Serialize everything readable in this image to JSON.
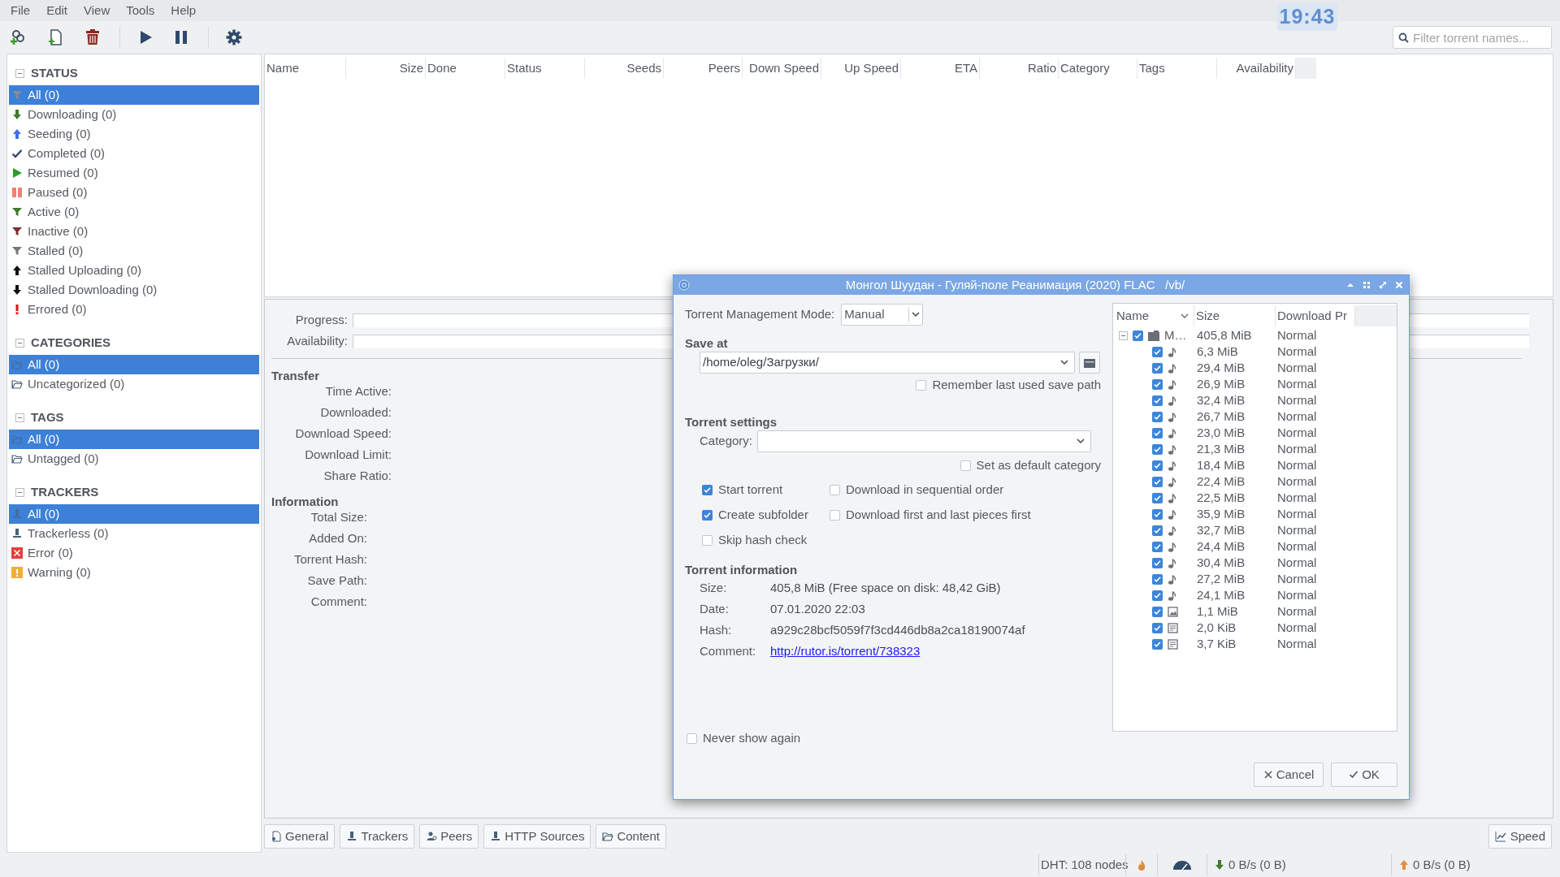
{
  "menu": [
    "File",
    "Edit",
    "View",
    "Tools",
    "Help"
  ],
  "clock": "19:43",
  "filter": {
    "placeholder": "Filter torrent names..."
  },
  "sidebar": [
    {
      "title": "STATUS",
      "expanded": true,
      "items": [
        {
          "label": "All (0)",
          "kind": "all",
          "selected": true
        },
        {
          "label": "Downloading (0)",
          "kind": "downloading",
          "selected": false
        },
        {
          "label": "Seeding (0)",
          "kind": "seeding",
          "selected": false
        },
        {
          "label": "Completed (0)",
          "kind": "completed",
          "selected": false
        },
        {
          "label": "Resumed (0)",
          "kind": "resumed",
          "selected": false
        },
        {
          "label": "Paused (0)",
          "kind": "paused",
          "selected": false
        },
        {
          "label": "Active (0)",
          "kind": "active",
          "selected": false
        },
        {
          "label": "Inactive (0)",
          "kind": "inactive",
          "selected": false
        },
        {
          "label": "Stalled (0)",
          "kind": "stalled",
          "selected": false
        },
        {
          "label": "Stalled Uploading (0)",
          "kind": "stalled_uploading",
          "selected": false
        },
        {
          "label": "Stalled Downloading (0)",
          "kind": "stalled_downloading",
          "selected": false
        },
        {
          "label": "Errored (0)",
          "kind": "errored",
          "selected": false
        }
      ]
    },
    {
      "title": "CATEGORIES",
      "expanded": true,
      "items": [
        {
          "label": "All (0)",
          "kind": "folder",
          "selected": true
        },
        {
          "label": "Uncategorized (0)",
          "kind": "folder",
          "selected": false
        }
      ]
    },
    {
      "title": "TAGS",
      "expanded": true,
      "items": [
        {
          "label": "All (0)",
          "kind": "folder",
          "selected": true
        },
        {
          "label": "Untagged (0)",
          "kind": "folder",
          "selected": false
        }
      ]
    },
    {
      "title": "TRACKERS",
      "expanded": true,
      "items": [
        {
          "label": "All (0)",
          "kind": "tracker",
          "selected": true
        },
        {
          "label": "Trackerless (0)",
          "kind": "tracker",
          "selected": false
        },
        {
          "label": "Error (0)",
          "kind": "error",
          "selected": false
        },
        {
          "label": "Warning (0)",
          "kind": "warning",
          "selected": false
        }
      ]
    }
  ],
  "torrent_table": {
    "columns": [
      "Name",
      "Size",
      "Done",
      "Status",
      "Seeds",
      "Peers",
      "Down Speed",
      "Up Speed",
      "ETA",
      "Ratio",
      "Category",
      "Tags",
      "Availability"
    ]
  },
  "details": {
    "bars": [
      {
        "label": "Progress:",
        "level": 0
      },
      {
        "label": "Availability:",
        "level": 0
      }
    ],
    "sections": [
      {
        "title": "Transfer",
        "fields": [
          "Time Active:",
          "Downloaded:",
          "Download Speed:",
          "Download Limit:",
          "Share Ratio:"
        ]
      },
      {
        "title": "Information",
        "fields": [
          "Total Size:",
          "Added On:",
          "Torrent Hash:",
          "Save Path:",
          "Comment:"
        ]
      }
    ]
  },
  "bottom_tabs": [
    {
      "label": "General",
      "kind": "general"
    },
    {
      "label": "Trackers",
      "kind": "trackers"
    },
    {
      "label": "Peers",
      "kind": "peers"
    },
    {
      "label": "HTTP Sources",
      "kind": "sources"
    },
    {
      "label": "Content",
      "kind": "content"
    }
  ],
  "speed_button": "Speed",
  "status_bar": {
    "dht": "DHT: 108 nodes",
    "download": "0 B/s (0 B)",
    "upload": "0 B/s (0 B)"
  },
  "dialog": {
    "title": "Монгол Шуудан - Гуляй-поле Реанимация (2020) FLAC   /vb/",
    "management_label": "Torrent Management Mode:",
    "management_mode": "Manual",
    "save_heading": "Save at",
    "save_path": "/home/oleg/Загрузки/",
    "remember": {
      "label": "Remember last used save path",
      "checked": false
    },
    "settings_heading": "Torrent settings",
    "category_label": "Category:",
    "default_category": {
      "label": "Set as default category",
      "checked": false
    },
    "options": [
      {
        "label": "Start torrent",
        "checked": true
      },
      {
        "label": "Download in sequential order",
        "checked": false
      },
      {
        "label": "Create subfolder",
        "checked": true
      },
      {
        "label": "Download first and last pieces first",
        "checked": false
      },
      {
        "label": "Skip hash check",
        "checked": false
      }
    ],
    "info_heading": "Torrent information",
    "info": [
      {
        "label": "Size:",
        "value": "405,8 MiB (Free space on disk: 48,42 GiB)",
        "kind": "text"
      },
      {
        "label": "Date:",
        "value": "07.01.2020 22:03",
        "kind": "text"
      },
      {
        "label": "Hash:",
        "value": "a929c28bcf5059f7f3cd446db8a2ca18190074af",
        "kind": "text"
      },
      {
        "label": "Comment:",
        "value": "http://rutor.is/torrent/738323",
        "kind": "link"
      }
    ],
    "never_show": {
      "label": "Never show again",
      "checked": false
    },
    "files": {
      "columns": [
        "Name",
        "Size",
        "Download Pr"
      ],
      "root": {
        "name": "M…",
        "size": "405,8 MiB",
        "priority": "Normal",
        "checked": true,
        "expanded": true,
        "children": [
          {
            "size": "6,3 MiB",
            "priority": "Normal",
            "checked": true,
            "kind": "audio"
          },
          {
            "size": "29,4 MiB",
            "priority": "Normal",
            "checked": true,
            "kind": "audio"
          },
          {
            "size": "26,9 MiB",
            "priority": "Normal",
            "checked": true,
            "kind": "audio"
          },
          {
            "size": "32,4 MiB",
            "priority": "Normal",
            "checked": true,
            "kind": "audio"
          },
          {
            "size": "26,7 MiB",
            "priority": "Normal",
            "checked": true,
            "kind": "audio"
          },
          {
            "size": "23,0 MiB",
            "priority": "Normal",
            "checked": true,
            "kind": "audio"
          },
          {
            "size": "21,3 MiB",
            "priority": "Normal",
            "checked": true,
            "kind": "audio"
          },
          {
            "size": "18,4 MiB",
            "priority": "Normal",
            "checked": true,
            "kind": "audio"
          },
          {
            "size": "22,4 MiB",
            "priority": "Normal",
            "checked": true,
            "kind": "audio"
          },
          {
            "size": "22,5 MiB",
            "priority": "Normal",
            "checked": true,
            "kind": "audio"
          },
          {
            "size": "35,9 MiB",
            "priority": "Normal",
            "checked": true,
            "kind": "audio"
          },
          {
            "size": "32,7 MiB",
            "priority": "Normal",
            "checked": true,
            "kind": "audio"
          },
          {
            "size": "24,4 MiB",
            "priority": "Normal",
            "checked": true,
            "kind": "audio"
          },
          {
            "size": "30,4 MiB",
            "priority": "Normal",
            "checked": true,
            "kind": "audio"
          },
          {
            "size": "27,2 MiB",
            "priority": "Normal",
            "checked": true,
            "kind": "audio"
          },
          {
            "size": "24,1 MiB",
            "priority": "Normal",
            "checked": true,
            "kind": "audio"
          },
          {
            "size": "1,1 MiB",
            "priority": "Normal",
            "checked": true,
            "kind": "image"
          },
          {
            "size": "2,0 KiB",
            "priority": "Normal",
            "checked": true,
            "kind": "text"
          },
          {
            "size": "3,7 KiB",
            "priority": "Normal",
            "checked": true,
            "kind": "text"
          }
        ]
      }
    },
    "buttons": [
      {
        "label": "Cancel",
        "kind": "cancel"
      },
      {
        "label": "OK",
        "kind": "ok"
      }
    ]
  }
}
